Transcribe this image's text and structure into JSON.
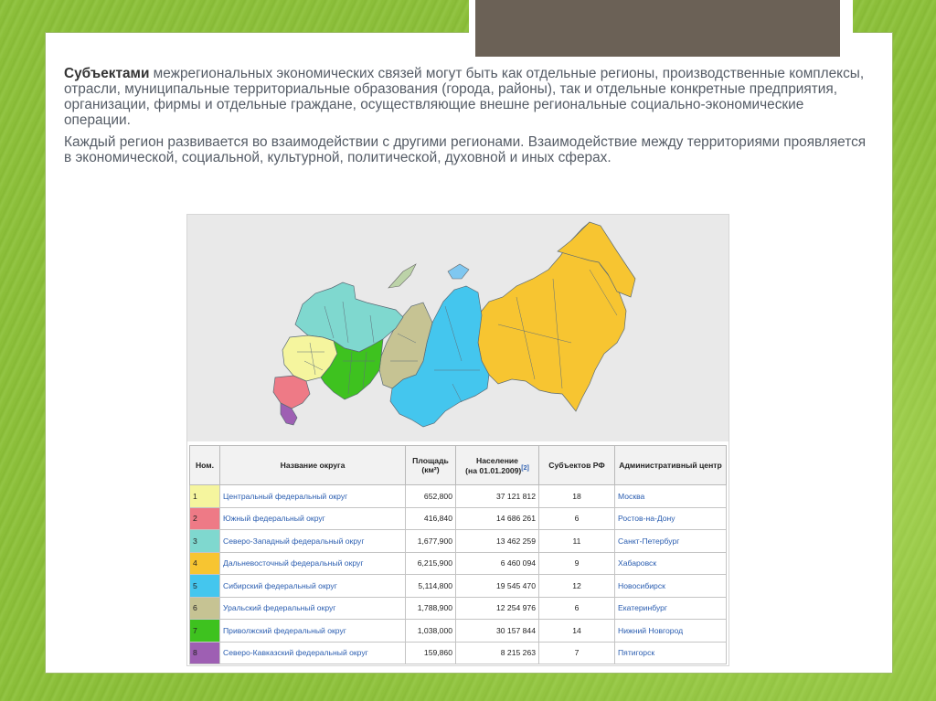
{
  "slide": {
    "paragraph1_bold": "Субъектами",
    "paragraph1_rest": " межрегиональных экономических связей могут быть как отдельные регионы, производственные комплексы, отрасли, муниципальные территориальные образования (города, районы), так и отдельные конкретные предприятия, организации, фирмы и отдельные граждане, осуществляющие внешне региональные социально-экономические операции.",
    "paragraph2": "Каждый регион развивается во взаимодействии с другими регионами. Взаимодействие между территориями проявляется в экономической, социальной, культурной, политической, духовной и иных сферах."
  },
  "colors": {
    "1": "#f5f59e",
    "2": "#ee7a86",
    "3": "#7fd8cf",
    "4": "#f7c531",
    "5": "#44c6ee",
    "6": "#c6c393",
    "7": "#3ec21f",
    "8": "#9e5fb3"
  },
  "table": {
    "headers": {
      "num": "Ном.",
      "name": "Название округа",
      "area": "Площадь",
      "area_unit": "(км²)",
      "population": "Население",
      "population_date": "(на 01.01.2009)",
      "population_ref": "[2]",
      "subjects": "Субъектов РФ",
      "center": "Административный центр"
    },
    "rows": [
      {
        "num": "1",
        "name": "Центральный федеральный округ",
        "area": "652,800",
        "population": "37 121 812",
        "subjects": "18",
        "center": "Москва"
      },
      {
        "num": "2",
        "name": "Южный федеральный округ",
        "area": "416,840",
        "population": "14 686 261",
        "subjects": "6",
        "center": "Ростов-на-Дону"
      },
      {
        "num": "3",
        "name": "Северо-Западный федеральный округ",
        "area": "1,677,900",
        "population": "13 462 259",
        "subjects": "11",
        "center": "Санкт-Петербург"
      },
      {
        "num": "4",
        "name": "Дальневосточный федеральный округ",
        "area": "6,215,900",
        "population": "6 460 094",
        "subjects": "9",
        "center": "Хабаровск"
      },
      {
        "num": "5",
        "name": "Сибирский федеральный округ",
        "area": "5,114,800",
        "population": "19 545 470",
        "subjects": "12",
        "center": "Новосибирск"
      },
      {
        "num": "6",
        "name": "Уральский федеральный округ",
        "area": "1,788,900",
        "population": "12 254 976",
        "subjects": "6",
        "center": "Екатеринбург"
      },
      {
        "num": "7",
        "name": "Приволжский федеральный округ",
        "area": "1,038,000",
        "population": "30 157 844",
        "subjects": "14",
        "center": "Нижний Новгород"
      },
      {
        "num": "8",
        "name": "Северо-Кавказский федеральный округ",
        "area": "159,860",
        "population": "8 215 263",
        "subjects": "7",
        "center": "Пятигорск"
      }
    ]
  }
}
